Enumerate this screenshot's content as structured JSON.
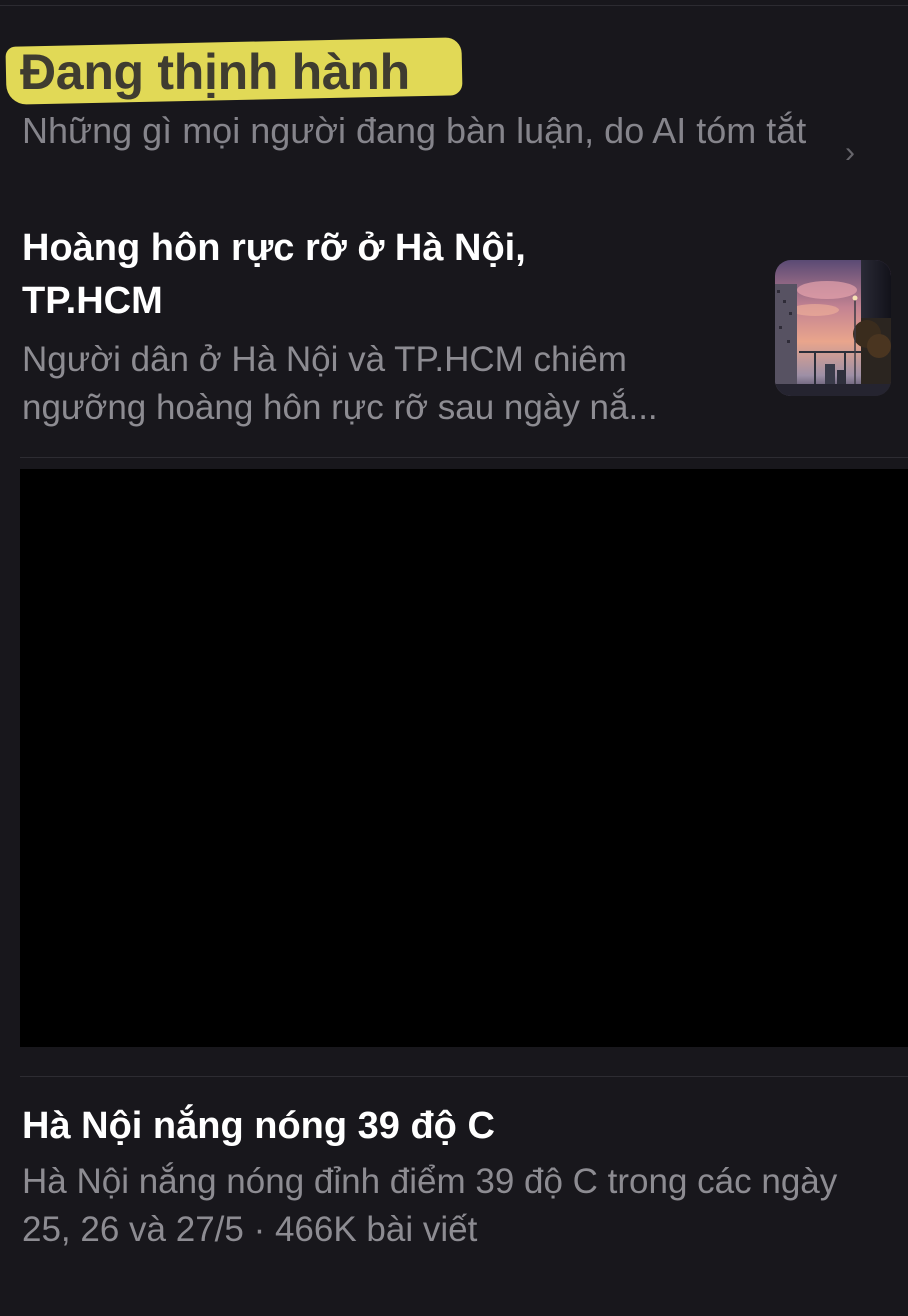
{
  "trending": {
    "title": "Đang thịnh hành",
    "subtitle": "Những gì mọi người đang bàn luận, do AI tóm tắt",
    "chevron": "›"
  },
  "stories": [
    {
      "title": "Hoàng hôn rực rỡ ở Hà Nội, TP.HCM",
      "summary": "Người dân ở Hà Nội và TP.HCM chiêm ngưỡng hoàng hôn rực rỡ sau ngày nắ...",
      "thumbnail_icon": "sunset-city-image"
    },
    {
      "title": "Hà Nội nắng nóng 39 độ C",
      "summary": "Hà Nội nắng nóng đỉnh điểm 39 độ C trong các ngày 25, 26 và 27/5 · 466K bài viết"
    }
  ],
  "colors": {
    "background": "#18171c",
    "highlight": "#f1e85a",
    "primary_text": "#ffffff",
    "secondary_text": "#8d8c92"
  }
}
